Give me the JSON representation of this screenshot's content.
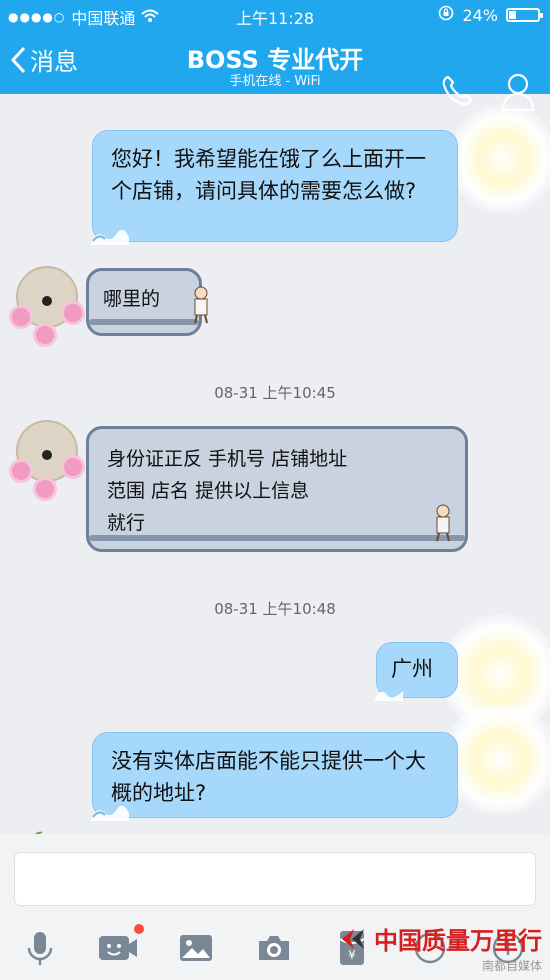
{
  "status": {
    "carrier": "中国联通",
    "time": "上午11:28",
    "battery": "24%",
    "battery_level": 0.24
  },
  "nav": {
    "back_label": "消息",
    "title": "BOSS  专业代开",
    "subtitle": "手机在线 - WiFi"
  },
  "messages": {
    "m1": "您好！我希望能在饿了么上面开一个店铺，请问具体的需要怎么做?",
    "m2": "哪里的",
    "t1": "08-31 上午10:45",
    "m3_line1": "身份证正反   手机号    店铺地址",
    "m3_line2": "范围   店名        提供以上信息",
    "m3_line3": "就行",
    "t2": "08-31 上午10:48",
    "m4": "广州",
    "m5": "没有实体店面能不能只提供一个大概的地址?"
  },
  "input": {
    "placeholder": ""
  },
  "watermark": {
    "main": "中国质量万里行",
    "sub": "南都自媒体"
  },
  "colors": {
    "header": "#21a7ee",
    "out_bubble": "#a6d8fb",
    "in_bubble": "#c9d2df",
    "accent_red": "#ff4b3e"
  }
}
